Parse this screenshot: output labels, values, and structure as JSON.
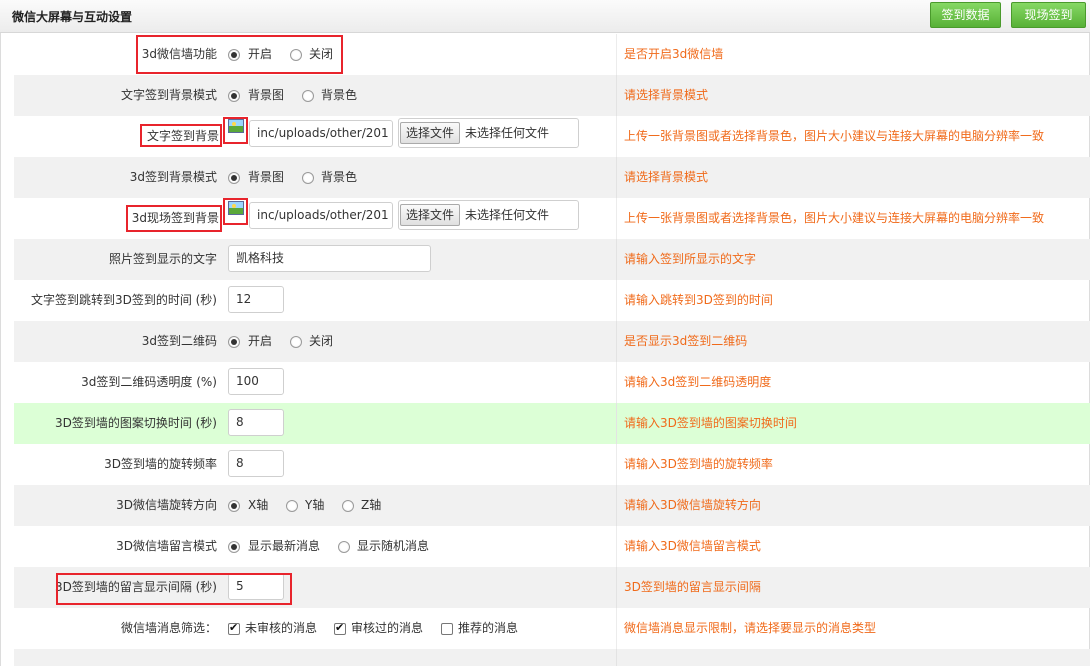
{
  "header": {
    "title": "微信大屏幕与互动设置",
    "btn_signin_data": "签到数据",
    "btn_onsite_signin": "现场签到"
  },
  "colors": {
    "hint": "#f06a1a",
    "highlight": "#e8242c",
    "green_row": "#dcffd6",
    "button_green": "#6cc54b"
  },
  "rows": {
    "r3dwall": {
      "label": "3d微信墙功能",
      "opt1": "开启",
      "opt2": "关闭",
      "hint": "是否开启3d微信墙"
    },
    "textbgmode": {
      "label": "文字签到背景模式",
      "opt1": "背景图",
      "opt2": "背景色",
      "hint": "请选择背景模式"
    },
    "textbg": {
      "label": "文字签到背景",
      "path": "inc/uploads/other/201",
      "file_btn": "选择文件",
      "file_status": "未选择任何文件",
      "hint": "上传一张背景图或者选择背景色，图片大小建议与连接大屏幕的电脑分辨率一致"
    },
    "bg3dmode": {
      "label": "3d签到背景模式",
      "opt1": "背景图",
      "opt2": "背景色",
      "hint": "请选择背景模式"
    },
    "onsitebg": {
      "label": "3d现场签到背景",
      "path": "inc/uploads/other/201",
      "file_btn": "选择文件",
      "file_status": "未选择任何文件",
      "hint": "上传一张背景图或者选择背景色，图片大小建议与连接大屏幕的电脑分辨率一致"
    },
    "phototext": {
      "label": "照片签到显示的文字",
      "value": "凯格科技",
      "hint": "请输入签到所显示的文字"
    },
    "jumptime": {
      "label": "文字签到跳转到3D签到的时间 (秒)",
      "value": "12",
      "hint": "请输入跳转到3D签到的时间"
    },
    "qrcode": {
      "label": "3d签到二维码",
      "opt1": "开启",
      "opt2": "关闭",
      "hint": "是否显示3d签到二维码"
    },
    "qropacity": {
      "label": "3d签到二维码透明度 (%)",
      "value": "100",
      "hint": "请输入3d签到二维码透明度"
    },
    "patterntime": {
      "label": "3D签到墙的图案切换时间 (秒)",
      "value": "8",
      "hint": "请输入3D签到墙的图案切换时间"
    },
    "rotatefreq": {
      "label": "3D签到墙的旋转频率",
      "value": "8",
      "hint": "请输入3D签到墙的旋转频率"
    },
    "rotatedir": {
      "label": "3D微信墙旋转方向",
      "opt1": "X轴",
      "opt2": "Y轴",
      "opt3": "Z轴",
      "hint": "请输入3D微信墙旋转方向"
    },
    "msgmode": {
      "label": "3D微信墙留言模式",
      "opt1": "显示最新消息",
      "opt2": "显示随机消息",
      "hint": "请输入3D微信墙留言模式"
    },
    "msginterval": {
      "label": "3D签到墙的留言显示间隔 (秒)",
      "value": "5",
      "hint": "3D签到墙的留言显示间隔"
    },
    "msgfilter": {
      "label": "微信墙消息筛选：",
      "opt1": "未审核的消息",
      "opt2": "审核过的消息",
      "opt3": "推荐的消息",
      "hint": "微信墙消息显示限制，请选择要显示的消息类型"
    }
  }
}
